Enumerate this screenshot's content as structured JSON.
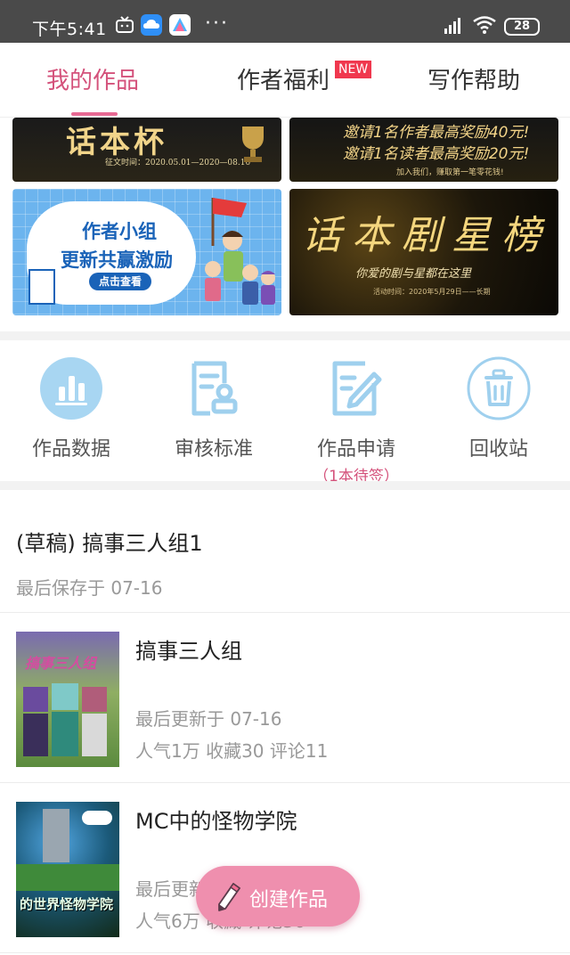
{
  "status_bar": {
    "time": "下午5:41",
    "more": "···",
    "battery": "28"
  },
  "tabs": [
    {
      "label": "我的作品",
      "active": true
    },
    {
      "label": "作者福利",
      "badge": "NEW"
    },
    {
      "label": "写作帮助"
    }
  ],
  "banners": {
    "b1": {
      "title": "话本杯",
      "subtitle": "征文时间：2020.05.01—2020—08.10"
    },
    "b2": {
      "line1": "邀请1名作者最高奖励40元!",
      "line2": "邀请1名读者最高奖励20元!",
      "small": "加入我们，赚取第一笔零花钱!"
    },
    "b3": {
      "line1": "作者小组",
      "line2": "更新共赢激励",
      "button": "点击查看"
    },
    "b4": {
      "title": "话本剧星榜",
      "subtitle": "你爱的剧与星都在这里",
      "small": "活动时间：2020年5月29日——长期"
    }
  },
  "quick_actions": [
    {
      "label": "作品数据",
      "icon": "bar-chart-icon"
    },
    {
      "label": "审核标准",
      "icon": "review-document-icon"
    },
    {
      "label": "作品申请",
      "icon": "edit-document-icon",
      "note": "（1本待签）"
    },
    {
      "label": "回收站",
      "icon": "trash-icon"
    }
  ],
  "draft": {
    "title": "(草稿) 搞事三人组1",
    "saved": "最后保存于 07-16"
  },
  "works": [
    {
      "title": "搞事三人组",
      "cover_text": "搞事三人组",
      "updated": "最后更新于 07-16",
      "stats": "人气1万  收藏30  评论11"
    },
    {
      "title": "MC中的怪物学院",
      "cover_text": "的世界怪物学院",
      "updated": "最后更新于",
      "stats": "人气6万  收藏  评论36"
    }
  ],
  "fab": {
    "label": "创建作品"
  },
  "colors": {
    "accent": "#d4527b",
    "tab_underline": "#e86a94",
    "fab": "#ef8fae",
    "badge": "#f0384e",
    "icon_blue": "#9fd0ee"
  }
}
